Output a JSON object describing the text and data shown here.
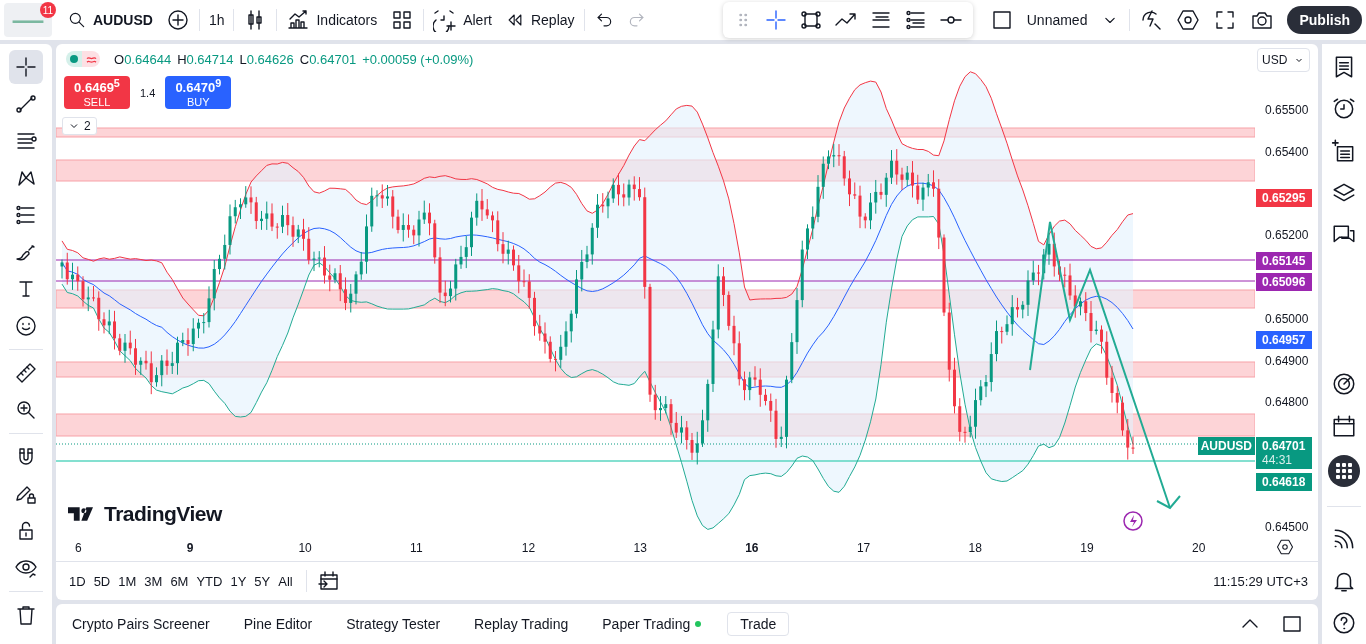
{
  "header": {
    "notification_count": "11",
    "symbol": "AUDUSD",
    "interval": "1h",
    "indicators": "Indicators",
    "alert": "Alert",
    "replay": "Replay",
    "layout_name": "Unnamed",
    "publish": "Publish"
  },
  "legend": {
    "items": [
      {
        "label": "O",
        "value": "0.64644"
      },
      {
        "label": "H",
        "value": "0.64714"
      },
      {
        "label": "L",
        "value": "0.64626"
      },
      {
        "label": "C",
        "value": "0.64701"
      }
    ],
    "change": "+0.00059 (+0.09%)"
  },
  "trade": {
    "sell_price": "0.6469$^{5}$",
    "sell_label": "SELL",
    "spread": "1.4",
    "buy_price": "0.6470$^{9}$",
    "buy_label": "BUY"
  },
  "indicator_count": "2",
  "brand": "TradingView",
  "currency": "USD",
  "price_axis": {
    "ticks": [
      "0.65500",
      "0.65400",
      "0.65200",
      "0.65000",
      "0.64900",
      "0.64800",
      "0.64500"
    ],
    "tags": [
      {
        "text": "0.65295",
        "color": "#f23645"
      },
      {
        "text": "0.65145",
        "color": "#9c27b0"
      },
      {
        "text": "0.65096",
        "color": "#9c27b0"
      },
      {
        "text": "0.64957",
        "color": "#2962ff"
      },
      {
        "text": "0.64701",
        "sub": "44:31",
        "color": "#089981"
      },
      {
        "text": "0.64618",
        "color": "#089981"
      }
    ],
    "symbol_tag": "AUDUSD"
  },
  "time_axis": [
    {
      "label": "6",
      "kind": "day"
    },
    {
      "label": "9",
      "kind": "week"
    },
    {
      "label": "10",
      "kind": "day"
    },
    {
      "label": "11",
      "kind": "day"
    },
    {
      "label": "12",
      "kind": "day"
    },
    {
      "label": "13",
      "kind": "day"
    },
    {
      "label": "16",
      "kind": "week"
    },
    {
      "label": "17",
      "kind": "day"
    },
    {
      "label": "18",
      "kind": "day"
    },
    {
      "label": "19",
      "kind": "day"
    },
    {
      "label": "20",
      "kind": "day"
    }
  ],
  "ranges": [
    "1D",
    "5D",
    "1M",
    "3M",
    "6M",
    "YTD",
    "1Y",
    "5Y",
    "All"
  ],
  "clock": "11:15:29 UTC+3",
  "bottom_tabs": [
    {
      "label": "Crypto Pairs Screener",
      "kind": "tab"
    },
    {
      "label": "Pine Editor",
      "kind": "tab"
    },
    {
      "label": "Strategy Tester",
      "kind": "tab"
    },
    {
      "label": "Replay Trading",
      "kind": "tab"
    },
    {
      "label": "Paper Trading",
      "kind": "status"
    },
    {
      "label": "Trade",
      "kind": "button"
    }
  ],
  "tools": [
    {
      "kind": "crosshair",
      "selected": true
    },
    {
      "kind": "trendline",
      "selected": false
    },
    {
      "kind": "fib",
      "selected": false
    },
    {
      "kind": "pattern",
      "selected": false
    },
    {
      "kind": "projection",
      "selected": false
    },
    {
      "kind": "brush",
      "selected": false
    },
    {
      "kind": "text",
      "selected": false
    },
    {
      "kind": "emoji",
      "selected": false
    },
    {
      "kind": "ruler",
      "selected": false
    },
    {
      "kind": "zoom",
      "selected": false
    },
    {
      "kind": "magnet",
      "selected": false
    },
    {
      "kind": "pencil-lock",
      "selected": false
    },
    {
      "kind": "lock",
      "selected": false
    },
    {
      "kind": "eye",
      "selected": false
    },
    {
      "kind": "trash",
      "selected": false
    }
  ]
}
